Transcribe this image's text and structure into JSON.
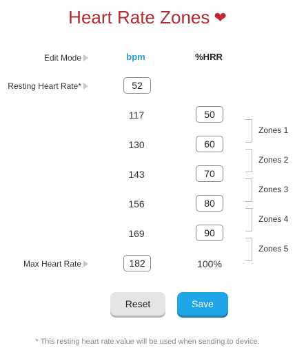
{
  "title": "Heart Rate Zones",
  "heart_icon": "heart-icon",
  "edit_mode": {
    "label": "Edit Mode",
    "col_bpm": "bpm",
    "col_hrr": "%HRR"
  },
  "resting": {
    "label": "Resting Heart Rate*",
    "value": "52"
  },
  "zones": [
    {
      "bpm": "117",
      "hrr": "50"
    },
    {
      "bpm": "130",
      "hrr": "60"
    },
    {
      "bpm": "143",
      "hrr": "70"
    },
    {
      "bpm": "156",
      "hrr": "80"
    },
    {
      "bpm": "169",
      "hrr": "90"
    }
  ],
  "zone_labels": [
    "Zones 1",
    "Zones 2",
    "Zones 3",
    "Zones 4",
    "Zones 5"
  ],
  "max": {
    "label": "Max Heart Rate",
    "value": "182",
    "hrr": "100%"
  },
  "buttons": {
    "reset": "Reset",
    "save": "Save"
  },
  "footnote": "* This resting heart rate value will be used when sending to device.",
  "colors": {
    "title": "#b22a2f",
    "bpm_header": "#2a9fd8",
    "save_button": "#1ea6e6",
    "reset_button": "#e4e4e4"
  }
}
